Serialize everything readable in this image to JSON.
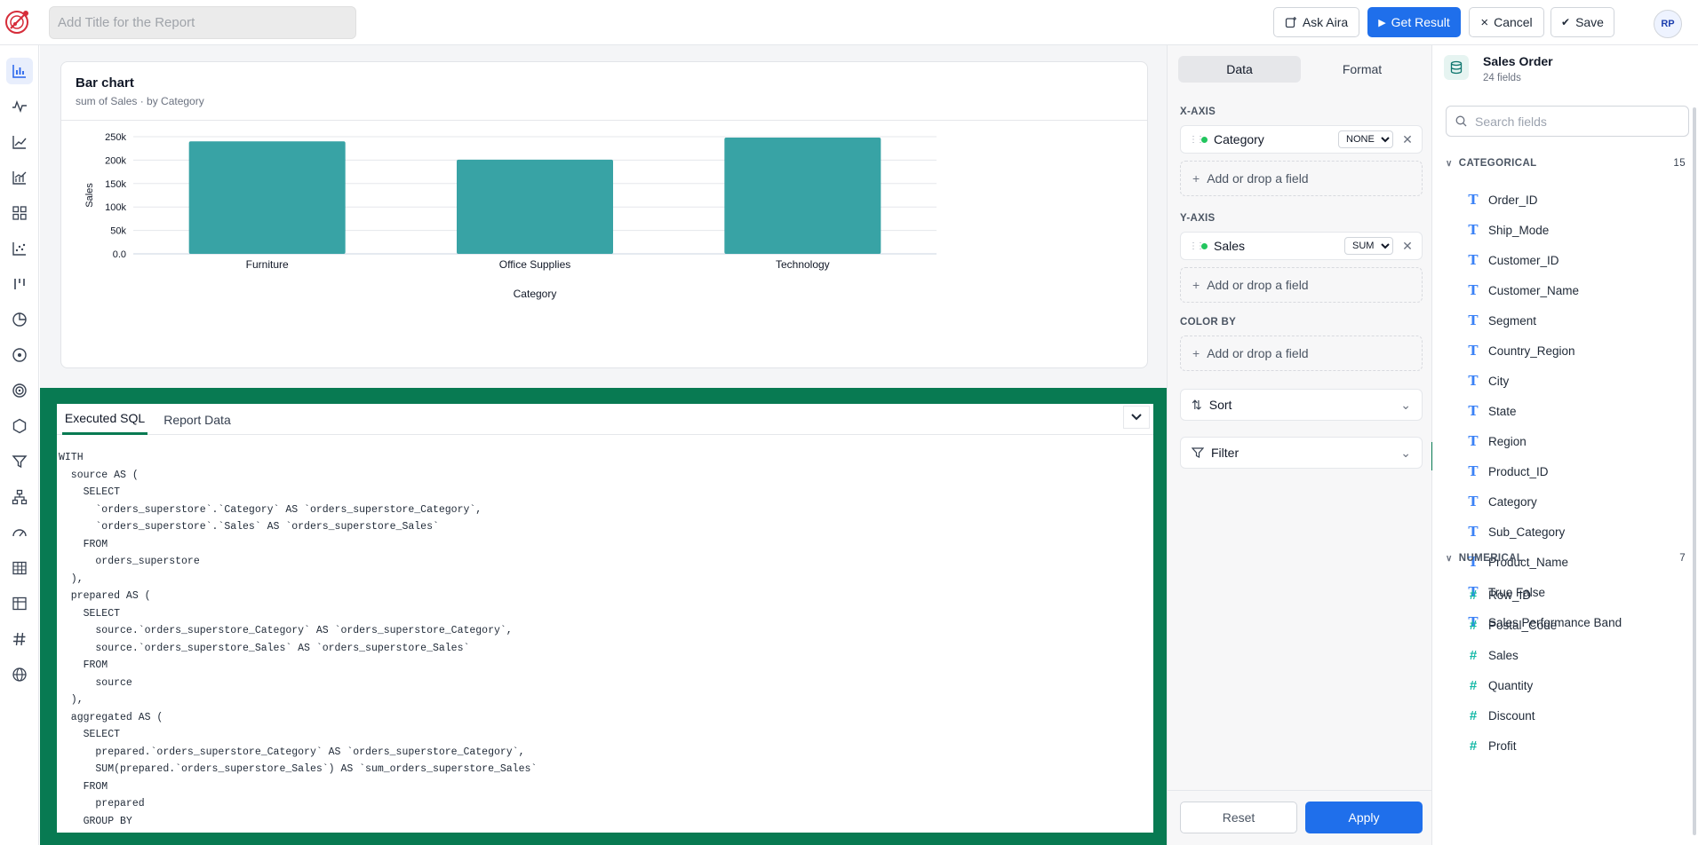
{
  "header": {
    "title_placeholder": "Add Title for the Report",
    "ask_aira": "Ask Aira",
    "get_result": "Get Result",
    "cancel": "Cancel",
    "save": "Save",
    "avatar": "RP"
  },
  "leftnav": {
    "icons": [
      "bar-chart-icon",
      "line-chart-icon",
      "line-trend-icon",
      "combo-chart-icon",
      "grid-icon",
      "scatter-icon",
      "range-icon",
      "pie-chart-icon",
      "donut-icon",
      "radar-icon",
      "hexagon-icon",
      "funnel-icon",
      "tree-icon",
      "gauge-icon",
      "table-icon",
      "pivot-icon",
      "number-icon",
      "globe-icon"
    ],
    "active": "bar-chart-icon"
  },
  "chart_card": {
    "title": "Bar chart",
    "subtitle": "sum of Sales · by Category"
  },
  "chart_data": {
    "type": "bar",
    "categories": [
      "Furniture",
      "Office Supplies",
      "Technology"
    ],
    "values": [
      240000,
      201000,
      248000
    ],
    "xlabel": "Category",
    "ylabel": "Sales",
    "ylim": [
      0,
      250000
    ],
    "yticks": [
      0,
      50000,
      100000,
      150000,
      200000,
      250000
    ],
    "ytick_labels": [
      "0.0",
      "50k",
      "100k",
      "150k",
      "200k",
      "250k"
    ],
    "color": "#38a3a5",
    "grid": true
  },
  "sql_panel": {
    "tabs": [
      "Executed SQL",
      "Report Data"
    ],
    "active_tab": "Executed SQL",
    "code": "WITH\n  source AS (\n    SELECT\n      `orders_superstore`.`Category` AS `orders_superstore_Category`,\n      `orders_superstore`.`Sales` AS `orders_superstore_Sales`\n    FROM\n      orders_superstore\n  ),\n  prepared AS (\n    SELECT\n      source.`orders_superstore_Category` AS `orders_superstore_Category`,\n      source.`orders_superstore_Sales` AS `orders_superstore_Sales`\n    FROM\n      source\n  ),\n  aggregated AS (\n    SELECT\n      prepared.`orders_superstore_Category` AS `orders_superstore_Category`,\n      SUM(prepared.`orders_superstore_Sales`) AS `sum_orders_superstore_Sales`\n    FROM\n      prepared\n    GROUP BY"
  },
  "config": {
    "tabs": [
      "Data",
      "Format"
    ],
    "active_tab": "Data",
    "x_axis": {
      "label": "X-AXIS",
      "field": "Category",
      "agg": "NONE",
      "agg_options": [
        "NONE"
      ]
    },
    "y_axis": {
      "label": "Y-AXIS",
      "field": "Sales",
      "agg": "SUM",
      "agg_options": [
        "SUM"
      ]
    },
    "color_by": {
      "label": "COLOR BY"
    },
    "drop_text": "Add or drop a field",
    "sort": "Sort",
    "filter": "Filter",
    "reset": "Reset",
    "apply": "Apply"
  },
  "fields": {
    "datasource": "Sales Order",
    "field_count": "24 fields",
    "search_placeholder": "Search fields",
    "categorical": {
      "label": "CATEGORICAL",
      "count": "15",
      "items": [
        "Order_ID",
        "Ship_Mode",
        "Customer_ID",
        "Customer_Name",
        "Segment",
        "Country_Region",
        "City",
        "State",
        "Region",
        "Product_ID",
        "Category",
        "Sub_Category",
        "Product_Name",
        "True False",
        "Sales Performance Band"
      ]
    },
    "numerical": {
      "label": "NUMERICAL",
      "count": "7",
      "items": [
        "Row_ID",
        "Postal_Code",
        "Sales",
        "Quantity",
        "Discount",
        "Profit"
      ]
    }
  }
}
